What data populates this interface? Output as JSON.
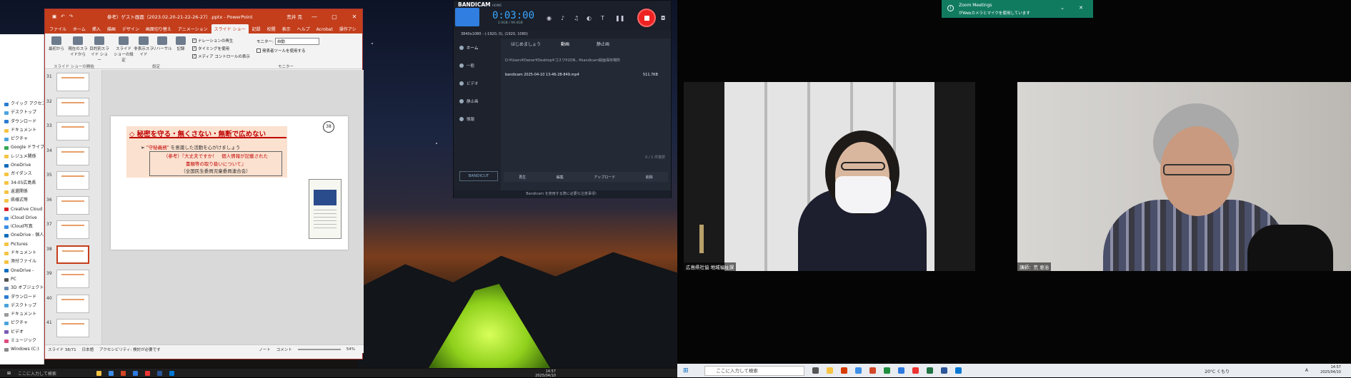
{
  "powerpoint": {
    "title": "参考）ゲスト画面（2023.02.20-21-22-26-27）.pptx - PowerPoint",
    "user_label": "荒井 克",
    "tabs": [
      "ファイル",
      "ホーム",
      "挿入",
      "描画",
      "デザイン",
      "画面切り替え",
      "アニメーション",
      "スライド ショー",
      "記録",
      "校閲",
      "表示",
      "ヘルプ",
      "Acrobat",
      "操作アシ"
    ],
    "active_tab": "スライド ショー",
    "ribbon": {
      "from_start": "最初から",
      "from_current": "現在のスライドから",
      "online": "オンライン プレゼンテーション",
      "custom": "目的別スライド ショー",
      "group_start": "スライド ショーの開始",
      "setup": "スライド ショーの設定",
      "hide": "非表示スライド",
      "rehearse": "リハーサル",
      "record": "記録",
      "group_setup": "設定",
      "chk_narration": "ナレーションの再生",
      "chk_timing": "タイミングを使用",
      "chk_media": "メディア コントロールの表示",
      "monitor_label": "モニター:",
      "monitor_value": "自動",
      "presenter_view": "発表者ツールを使用する",
      "group_monitor": "モニター"
    },
    "thumb_numbers": [
      "31",
      "32",
      "33",
      "34",
      "35",
      "36",
      "37",
      "38",
      "39",
      "40",
      "41"
    ],
    "selected_thumb": "38",
    "slide": {
      "number": "38",
      "heading": "◇ 秘密を守る・無くさない・無断で広めない",
      "bullet_pre": "➢ ",
      "bullet_em": "\"守秘義務\"",
      "bullet_post": " を意識した活動を心がけましょう",
      "ref_line1": "（参考）『大丈夫ですか！　個人情報が記載された",
      "ref_line2": "書類等の取り扱いについて』",
      "ref_line3": "（全国民生委員児童委員連合会）"
    },
    "status": {
      "slide_pos": "スライド 38/71",
      "lang": "日本語",
      "accessibility": "アクセシビリティ: 検討が必要です",
      "notes": "ノート",
      "comments": "コメント",
      "zoom": "54%"
    }
  },
  "explorer": {
    "items": [
      "クイック アクセス",
      "デスクトップ",
      "ダウンロード",
      "ドキュメント",
      "ピクチャ",
      "Google ドライブ",
      "レジュメ関係",
      "OneDrive",
      "ガイダンス",
      "34-05広島県",
      "返還関係",
      "県様式等",
      "Creative Cloud",
      "iCloud Drive",
      "iCloud写真",
      "OneDrive - 個人用",
      "Pictures",
      "ドキュメント",
      "添付ファイル",
      "OneDrive - ",
      "PC",
      "3D オブジェクト",
      "ダウンロード",
      "デスクトップ",
      "ドキュメント",
      "ピクチャ",
      "ビデオ",
      "ミュージック",
      "Windows (C:)"
    ]
  },
  "bandicam": {
    "logo": "BANDICAM",
    "logo_sub": "HOME",
    "timer": "0:03:00",
    "size": "2.0GB / 99.4GB",
    "resolution": "3840x1080 - (-1920, 0), (1920, 1080)",
    "side": [
      "ホーム",
      "一般",
      "ビデオ",
      "静止画",
      "情報"
    ],
    "tabs": [
      "はじめましょう",
      "動画",
      "静止画"
    ],
    "path": "D:¥Users¥Owner¥Desktop¥ゴスワ¥2ON...¥bandicam録画保存場所",
    "file_name": "bandicam 2025-04-10 13-46-28-849.mp4",
    "file_size": "511.7KB",
    "selected_count": "0 / 1 件選択",
    "buttons": [
      "再生",
      "編集",
      "アップロード",
      "削除"
    ],
    "brand": "BANDICUT",
    "footer": "Bandicam を使用する際に必要な注意事項！"
  },
  "zoom": {
    "notif_title": "Zoom Meetings",
    "notif_body": "がWebカメラとマイクを使用しています",
    "video1_label": "広島県社協 地域福祉課",
    "video2_label": "講師：荒 恵治"
  },
  "taskbar_left": {
    "search": "ここに入力して検索",
    "time": "14:57",
    "date": "2025/04/10"
  },
  "taskbar_right": {
    "search": "ここに入力して検索",
    "weather": "20°C くもり",
    "ime": "A",
    "time": "14:57",
    "date": "2025/04/10"
  }
}
